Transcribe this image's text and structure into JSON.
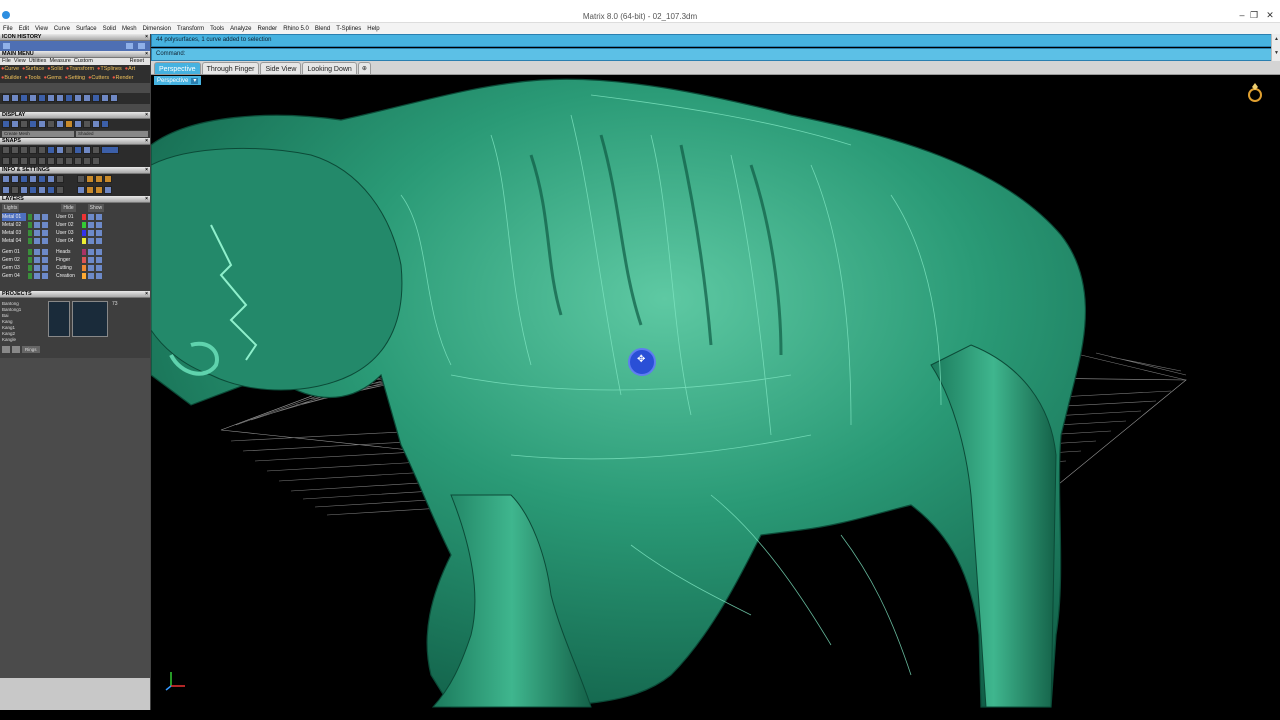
{
  "window": {
    "title": "Matrix 8.0 (64-bit) - 02_107.3dm",
    "minimize": "–",
    "restore": "❐",
    "close": "✕"
  },
  "menu": [
    "File",
    "Edit",
    "View",
    "Curve",
    "Surface",
    "Solid",
    "Mesh",
    "Dimension",
    "Transform",
    "Tools",
    "Analyze",
    "Render",
    "Rhino 5.0",
    "Blend",
    "T-Splines",
    "Help"
  ],
  "left_panel": {
    "icon_history": "ICON HISTORY",
    "main_menu": "MAIN MENU",
    "main_menu_items": [
      "File",
      "View",
      "Utilities",
      "Measure",
      "Custom"
    ],
    "reset": "Reset",
    "row1": [
      "Curve",
      "Surface",
      "Solid",
      "Transform",
      "TSplines",
      "Art"
    ],
    "row2": [
      "Builder",
      "Tools",
      "Gems",
      "Setting",
      "Cutters",
      "Render"
    ],
    "display": "DISPLAY",
    "display_select_1": "Create Mesh",
    "display_select_2": "Shaded",
    "snaps": "SNAPS",
    "info_settings": "INFO & SETTINGS",
    "layers": "LAYERS",
    "layer_head": [
      "Lights",
      "Hide",
      "Show"
    ],
    "layers_left": [
      "Metal 01",
      "Metal 02",
      "Metal 03",
      "Metal 04",
      "Gem 01",
      "Gem 02",
      "Gem 03",
      "Gem 04"
    ],
    "layers_right": [
      "User 01",
      "User 02",
      "User 03",
      "User 04",
      "Heads",
      "Finger",
      "Cutting",
      "Creation"
    ],
    "projects": "PROJECTS",
    "project_list": [
      "Bantong",
      "Bantong1",
      "Bai",
      "Kang",
      "Kang1",
      "Kang2",
      "Kangle"
    ],
    "project_count": "73",
    "ring_button": "Rings"
  },
  "command": {
    "history": "44 polysurfaces, 1 curve added to selection",
    "prompt": "Command:"
  },
  "tabs": [
    "Perspective",
    "Through Finger",
    "Side View",
    "Looking Down"
  ],
  "tab_add": "⊕",
  "viewport": {
    "label": "Perspective",
    "label_caret": "▾"
  },
  "colors": {
    "accent": "#46b2e0",
    "model": "#1f8a6a",
    "grid": "#8a8a8a"
  }
}
